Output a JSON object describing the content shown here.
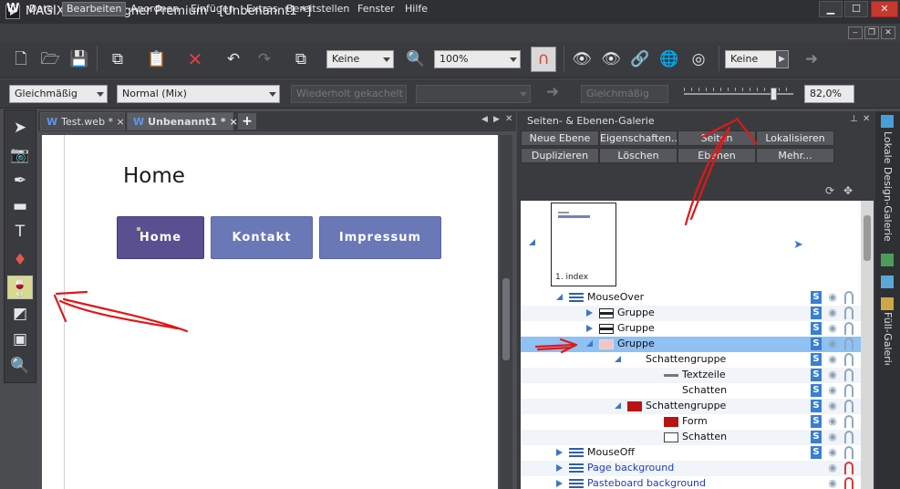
{
  "window": {
    "title": "MAGIX Web Designer Premium - [Unbenannt1 *]",
    "min": "▁",
    "max": "☐",
    "close": "✕"
  },
  "menu": {
    "logo": "W",
    "items": [
      "Datei",
      "Bearbeiten",
      "Anordnen",
      "Einfügen",
      "Extras",
      "Bereitstellen",
      "Fenster",
      "Hilfe"
    ],
    "mdi": [
      "‒",
      "❐",
      "✕"
    ]
  },
  "toolbar1": {
    "zoom_preset": "Keine",
    "zoom_value": "100%",
    "transition": "Keine"
  },
  "toolbar2": {
    "fill_type": "Gleichmäßig",
    "blend_mode": "Normal (Mix)",
    "repeat": "Wiederholt gekachelt",
    "profile": "Gleichmäßig",
    "transparency": "82,0%",
    "slider_fraction": 0.82
  },
  "tabs": [
    {
      "label": "Test.web *",
      "logo": "W",
      "close": "×"
    },
    {
      "label": "Unbenannt1 *",
      "logo": "W",
      "close": "×"
    }
  ],
  "tabs_add": "+",
  "page": {
    "heading": "Home",
    "nav": [
      {
        "label": "Home",
        "color": "#5a4f91"
      },
      {
        "label": "Kontakt",
        "color": "#6a78b8"
      },
      {
        "label": "Impressum",
        "color": "#6a78b8"
      }
    ]
  },
  "panel": {
    "title": "Seiten- & Ebenen-Galerie",
    "buttons_row1": [
      "Neue Ebene",
      "Eigenschaften...",
      "Seiten",
      "Lokalisieren"
    ],
    "buttons_row2": [
      "Duplizieren",
      "Löschen",
      "Ebenen",
      "Mehr..."
    ],
    "thumb_caption": "1. index",
    "tree": [
      {
        "label": "MouseOver",
        "level": 0,
        "expand": "open",
        "icon": "layer",
        "blue": false
      },
      {
        "label": "Gruppe",
        "level": 1,
        "expand": "closed-hollow",
        "icon": "group",
        "blue": false
      },
      {
        "label": "Gruppe",
        "level": 1,
        "expand": "closed-hollow",
        "icon": "group",
        "blue": false
      },
      {
        "label": "Gruppe",
        "level": 1,
        "expand": "open",
        "icon": "pink",
        "blue": false,
        "selected": true
      },
      {
        "label": "Schattengruppe",
        "level": 2,
        "expand": "open",
        "icon": "none",
        "blue": false
      },
      {
        "label": "Textzeile",
        "level": 3,
        "expand": "",
        "icon": "text",
        "blue": false
      },
      {
        "label": "Schatten",
        "level": 3,
        "expand": "",
        "icon": "none",
        "blue": false
      },
      {
        "label": "Schattengruppe",
        "level": 2,
        "expand": "open",
        "icon": "red",
        "blue": false
      },
      {
        "label": "Form",
        "level": 3,
        "expand": "",
        "icon": "red",
        "blue": false
      },
      {
        "label": "Schatten",
        "level": 3,
        "expand": "",
        "icon": "white",
        "blue": false
      },
      {
        "label": "MouseOff",
        "level": 0,
        "expand": "closed",
        "icon": "layer",
        "blue": false
      },
      {
        "label": "Page background",
        "level": 0,
        "expand": "closed",
        "icon": "layer",
        "blue": true
      },
      {
        "label": "Pasteboard background",
        "level": 0,
        "expand": "closed",
        "icon": "layer",
        "blue": true
      }
    ]
  },
  "side_tabs": [
    "Lokale Design-Galerie",
    "Füll-Galerie"
  ],
  "colors": {
    "accent": "#3a7fd0",
    "annotation": "#e01818"
  }
}
